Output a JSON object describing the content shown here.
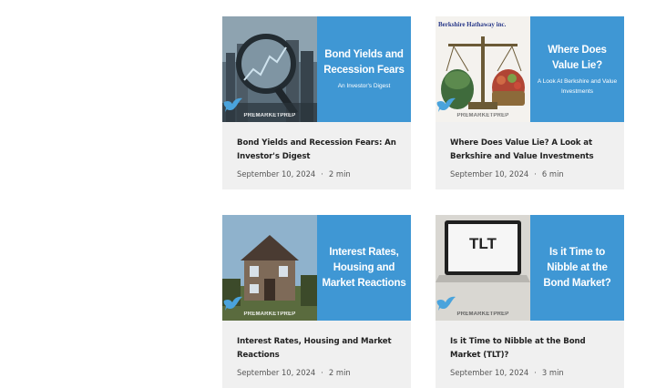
{
  "posts": [
    {
      "panel_title": "Bond Yields and Recession Fears",
      "panel_subtitle": "An Investor's Digest",
      "brand": "PREMARKETPREP",
      "title": "Bond Yields and Recession Fears: An Investor's Digest",
      "date": "September 10, 2024",
      "read_time": "2 min"
    },
    {
      "panel_title": "Where Does Value Lie?",
      "panel_subtitle": "A Look At Berkshire and Value Investments",
      "brand": "PREMARKETPREP",
      "photo_label": "Berkshire Hathaway inc.",
      "title": "Where Does Value Lie? A Look at Berkshire and Value Investments",
      "date": "September 10, 2024",
      "read_time": "6 min"
    },
    {
      "panel_title": "Interest Rates, Housing and Market Reactions",
      "brand": "PREMARKETPREP",
      "title": "Interest Rates, Housing and Market Reactions",
      "date": "September 10, 2024",
      "read_time": "2 min"
    },
    {
      "panel_title": "Is it Time to Nibble at the Bond Market?",
      "brand": "PREMARKETPREP",
      "photo_label": "TLT",
      "title": "Is it Time to Nibble at the Bond Market (TLT)?",
      "date": "September 10, 2024",
      "read_time": "3 min"
    }
  ],
  "meta_separator": "·"
}
